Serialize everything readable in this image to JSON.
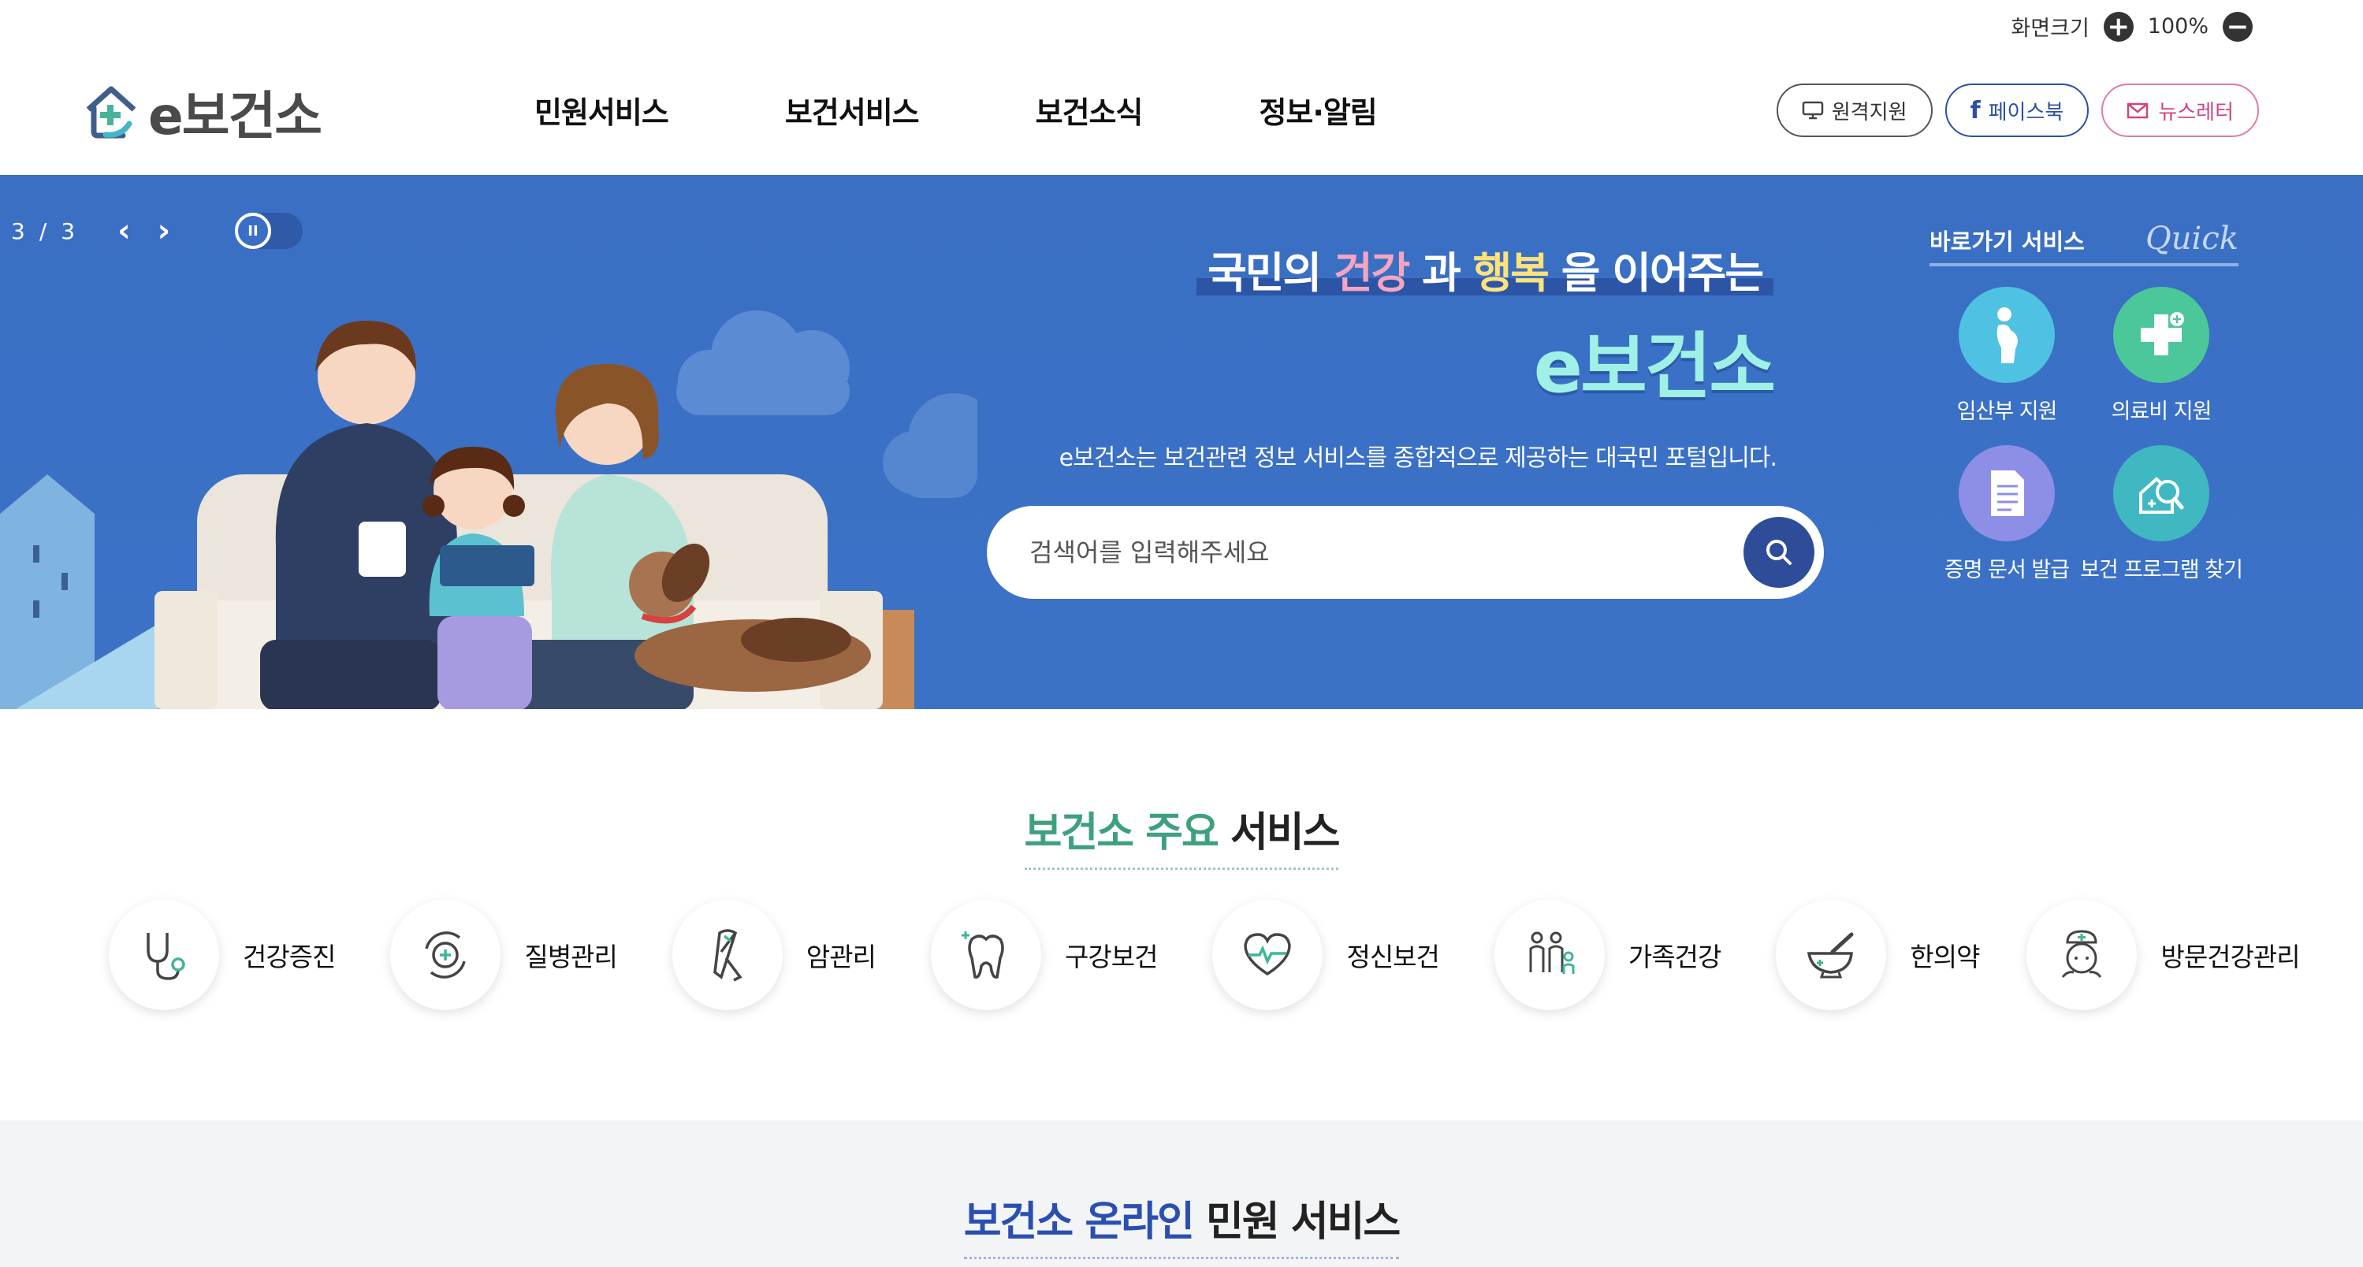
{
  "header": {
    "zoom_label": "화면크기",
    "zoom_value": "100%",
    "zoom_in": "+",
    "zoom_out": "−",
    "logo_text": "e보건소",
    "nav": [
      "민원서비스",
      "보건서비스",
      "보건소식",
      "정보·알림"
    ],
    "util": {
      "remote": "원격지원",
      "facebook": "페이스북",
      "newsletter": "뉴스레터"
    }
  },
  "hero": {
    "slide_current": "3",
    "slide_sep": "/",
    "slide_total": "3",
    "title_line": {
      "p1": "국민의 ",
      "w1": "건강",
      "p2": " 과 ",
      "w2": "행복",
      "p3": " 을 이어주는"
    },
    "main_title": "e보건소",
    "description": "e보건소는 보건관련 정보 서비스를 종합적으로 제공하는 대국민 포털입니다.",
    "search_placeholder": "검색어를 입력해주세요",
    "quick": {
      "title": "바로가기 서비스",
      "script": "Quick",
      "items": [
        {
          "label": "임산부 지원",
          "icon": "pregnant-icon",
          "color": "#4fc1e3"
        },
        {
          "label": "의료비 지원",
          "icon": "medical-cross-icon",
          "color": "#4cc79a"
        },
        {
          "label": "증명 문서 발급",
          "icon": "document-icon",
          "color": "#8d8ee6"
        },
        {
          "label": "보건 프로그램 찾기",
          "icon": "program-search-icon",
          "color": "#3fb8c2"
        }
      ]
    }
  },
  "main_services": {
    "title_accent": "보건소 주요",
    "title_rest": " 서비스",
    "items": [
      {
        "label": "건강증진",
        "icon": "stethoscope-icon"
      },
      {
        "label": "질병관리",
        "icon": "disease-care-icon"
      },
      {
        "label": "암관리",
        "icon": "ribbon-icon"
      },
      {
        "label": "구강보건",
        "icon": "tooth-icon"
      },
      {
        "label": "정신보건",
        "icon": "heart-pulse-icon"
      },
      {
        "label": "가족건강",
        "icon": "family-icon"
      },
      {
        "label": "한의약",
        "icon": "mortar-icon"
      },
      {
        "label": "방문건강관리",
        "icon": "nurse-icon"
      }
    ]
  },
  "online_services": {
    "title_accent": "보건소 온라인",
    "title_rest": " 민원 서비스"
  },
  "colors": {
    "hero_bg": "#3b70c5",
    "accent_green": "#3fa081",
    "accent_blue": "#2a4fb0",
    "search_button": "#2e4c97"
  }
}
